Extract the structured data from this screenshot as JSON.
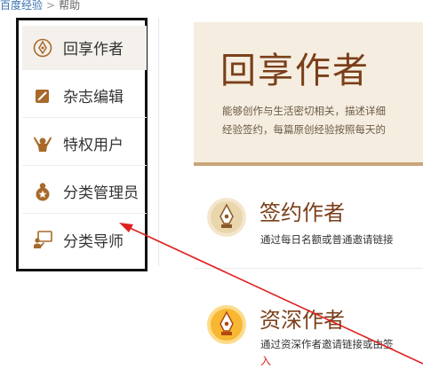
{
  "breadcrumb": {
    "home": "百度经验",
    "separator": ">",
    "current": "帮助"
  },
  "sidebar": {
    "items": [
      {
        "label": "回享作者",
        "icon": "pen-nib-icon",
        "active": true
      },
      {
        "label": "杂志编辑",
        "icon": "edit-icon",
        "active": false
      },
      {
        "label": "特权用户",
        "icon": "raised-arms-user-icon",
        "active": false
      },
      {
        "label": "分类管理员",
        "icon": "star-user-icon",
        "active": false
      },
      {
        "label": "分类导师",
        "icon": "teacher-icon",
        "active": false
      }
    ]
  },
  "hero": {
    "title": "回享作者",
    "desc_line1": "能够创作与生活密切相关，描述详细",
    "desc_line2": "经验签约，每篇原创经验按照每天的"
  },
  "sections": [
    {
      "title": "签约作者",
      "desc": "通过每日名额或普通邀请链接",
      "icon": "pen-nib-icon"
    },
    {
      "title": "资深作者",
      "desc": "通过资深作者邀请链接或由签",
      "icon": "pen-nib-icon"
    }
  ],
  "annotation": {
    "text": "入"
  },
  "colors": {
    "accent": "#7a3f1a",
    "hero_bg": "#f5ede0",
    "arrow": "#e02020",
    "icon_brown": "#a8692a"
  }
}
